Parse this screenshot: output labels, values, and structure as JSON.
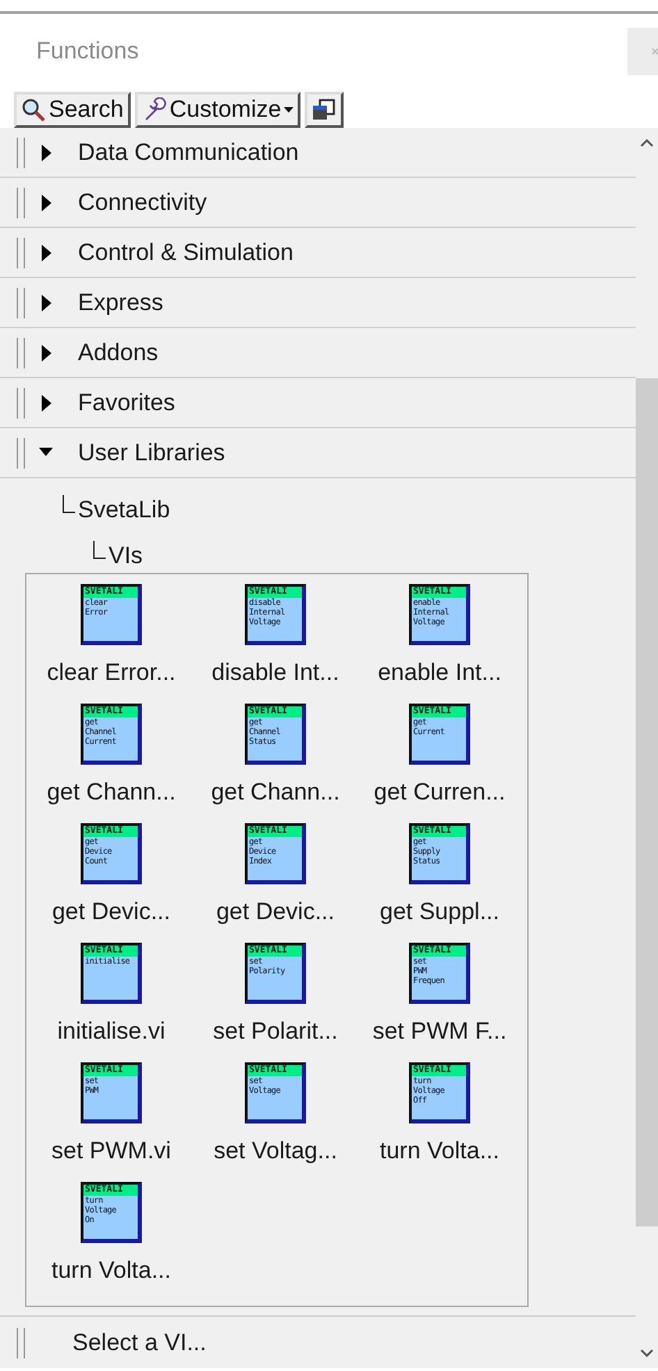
{
  "window": {
    "title": "Functions"
  },
  "toolbar": [
    {
      "kind": "search",
      "label": "Search"
    },
    {
      "kind": "menu",
      "label": "Customize"
    },
    {
      "kind": "icon"
    }
  ],
  "categories": [
    {
      "label": "Data Communication",
      "expanded": false
    },
    {
      "label": "Connectivity",
      "expanded": false
    },
    {
      "label": "Control & Simulation",
      "expanded": false
    },
    {
      "label": "Express",
      "expanded": false
    },
    {
      "label": "Addons",
      "expanded": false
    },
    {
      "label": "Favorites",
      "expanded": false
    },
    {
      "label": "User Libraries",
      "expanded": true,
      "children": [
        {
          "label": "SvetaLib",
          "children": [
            {
              "label": "VIs"
            }
          ]
        }
      ]
    }
  ],
  "palette": {
    "items": [
      {
        "label": "clear Error...",
        "icon_title": "SVETALI",
        "icon_lines": [
          "clear",
          "Error"
        ]
      },
      {
        "label": "disable Int...",
        "icon_title": "SVETALI",
        "icon_lines": [
          "disable",
          "Internal",
          "Voltage"
        ]
      },
      {
        "label": "enable Int...",
        "icon_title": "SVETALI",
        "icon_lines": [
          "enable",
          "Internal",
          "Voltage"
        ]
      },
      {
        "label": "get Chann...",
        "icon_title": "SVETALI",
        "icon_lines": [
          "get",
          "Channel",
          "Current"
        ]
      },
      {
        "label": "get Chann...",
        "icon_title": "SVETALI",
        "icon_lines": [
          "get",
          "Channel",
          "Status"
        ]
      },
      {
        "label": "get Curren...",
        "icon_title": "SVETALI",
        "icon_lines": [
          "get",
          "Current"
        ]
      },
      {
        "label": "get Devic...",
        "icon_title": "SVETALI",
        "icon_lines": [
          "get",
          "Device",
          "Count"
        ]
      },
      {
        "label": "get Devic...",
        "icon_title": "SVETALI",
        "icon_lines": [
          "get",
          "Device",
          "Index"
        ]
      },
      {
        "label": "get Suppl...",
        "icon_title": "SVETALI",
        "icon_lines": [
          "get",
          "Supply",
          "Status"
        ]
      },
      {
        "label": "initialise.vi",
        "icon_title": "SVETALI",
        "icon_lines": [
          "initialise"
        ]
      },
      {
        "label": "set Polarit...",
        "icon_title": "SVETALI",
        "icon_lines": [
          "set",
          "Polarity"
        ]
      },
      {
        "label": "set PWM F...",
        "icon_title": "SVETALI",
        "icon_lines": [
          "set",
          "PWM",
          "Frequen"
        ]
      },
      {
        "label": "set PWM.vi",
        "icon_title": "SVETALI",
        "icon_lines": [
          "set",
          "PWM"
        ]
      },
      {
        "label": "set Voltag...",
        "icon_title": "SVETALI",
        "icon_lines": [
          "set",
          "Voltage"
        ]
      },
      {
        "label": "turn Volta...",
        "icon_title": "SVETALI",
        "icon_lines": [
          "turn",
          "Voltage",
          "Off"
        ]
      },
      {
        "label": "turn Volta...",
        "icon_title": "SVETALI",
        "icon_lines": [
          "turn",
          "Voltage",
          "On"
        ]
      }
    ]
  },
  "footer": {
    "label": "Select a VI..."
  }
}
